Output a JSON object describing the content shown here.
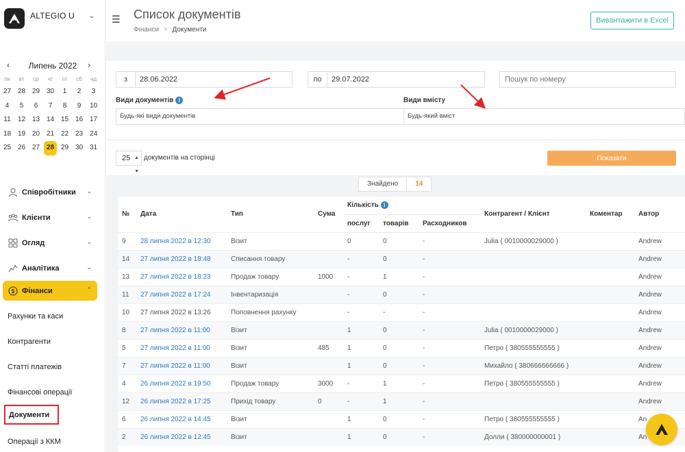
{
  "brand": {
    "name": "ALTEGIO U"
  },
  "calendar": {
    "month": "Липень 2022",
    "dow": [
      "пн",
      "вт",
      "ср",
      "чт",
      "пт",
      "сб",
      "нд"
    ],
    "days": [
      "27",
      "28",
      "29",
      "30",
      "1",
      "2",
      "3",
      "4",
      "5",
      "6",
      "7",
      "8",
      "9",
      "10",
      "11",
      "12",
      "13",
      "14",
      "15",
      "16",
      "17",
      "18",
      "19",
      "20",
      "21",
      "22",
      "23",
      "24",
      "25",
      "26",
      "27",
      "28",
      "29",
      "30",
      "31"
    ],
    "selected_index": 31
  },
  "nav": {
    "employees": "Співробітники",
    "clients": "Клієнти",
    "overview": "Огляд",
    "analytics": "Аналітика",
    "finances": "Фінанси",
    "sub": [
      "Рахунки та каси",
      "Контрагенти",
      "Статті платежів",
      "Фінансові операції",
      "Документи",
      "Операції з ККМ"
    ]
  },
  "header": {
    "title": "Список документів",
    "crumb_root": "Фінанси",
    "crumb_sep": ">",
    "crumb_current": "Документи",
    "excel_label": "Вивантажити в Excel"
  },
  "filters": {
    "from_prefix": "з",
    "from_value": "28.06.2022",
    "to_prefix": "по",
    "to_value": "29.07.2022",
    "search_placeholder": "Пошук по номеру",
    "doc_types_label": "Види документів",
    "doc_types_value": "Будь-які види документів",
    "content_label": "Види вмісту",
    "content_value": "Будь-який вміст",
    "info_glyph": "i"
  },
  "paging": {
    "per_page": "25",
    "per_page_label": "документів на сторінці",
    "show_label": "Показати",
    "found_label": "Знайдено",
    "found_count": "14"
  },
  "table": {
    "headers": {
      "no": "№",
      "date": "Дата",
      "type": "Тип",
      "sum": "Сума",
      "qty": "Кількість",
      "services": "послуг",
      "goods": "товарів",
      "consumables": "Расходников",
      "counterparty": "Контрагент / Клієнт",
      "comment": "Коментар",
      "author": "Автор"
    },
    "rows": [
      {
        "no": "9",
        "date": "28 липня 2022 в 12:30",
        "link": true,
        "type": "Візит",
        "sum": "",
        "services": "0",
        "goods": "0",
        "cons": "-",
        "party": "Julia ( 0010000029000 )",
        "comment": "",
        "author": "Andrew"
      },
      {
        "no": "14",
        "date": "27 липня 2022 в 18:48",
        "link": true,
        "type": "Списання товару",
        "sum": "",
        "services": "-",
        "goods": "0",
        "cons": "-",
        "party": "",
        "comment": "",
        "author": "Andrew"
      },
      {
        "no": "13",
        "date": "27 липня 2022 в 18:23",
        "link": true,
        "type": "Продаж товару",
        "sum": "1000",
        "services": "-",
        "goods": "1",
        "cons": "-",
        "party": "",
        "comment": "",
        "author": "Andrew"
      },
      {
        "no": "11",
        "date": "27 липня 2022 в 17:24",
        "link": true,
        "type": "Інвентаризація",
        "sum": "",
        "services": "-",
        "goods": "0",
        "cons": "-",
        "party": "",
        "comment": "",
        "author": "Andrew"
      },
      {
        "no": "10",
        "date": "27 липня 2022 в 13:26",
        "link": false,
        "type": "Поповнення рахунку",
        "sum": "",
        "services": "-",
        "goods": "-",
        "cons": "-",
        "party": "",
        "comment": "",
        "author": "Andrew"
      },
      {
        "no": "8",
        "date": "27 липня 2022 в 11:00",
        "link": true,
        "type": "Візит",
        "sum": "",
        "services": "1",
        "goods": "0",
        "cons": "-",
        "party": "Julia ( 0010000029000 )",
        "comment": "",
        "author": "Andrew"
      },
      {
        "no": "5",
        "date": "27 липня 2022 в 11:00",
        "link": true,
        "type": "Візит",
        "sum": "485",
        "services": "1",
        "goods": "0",
        "cons": "-",
        "party": "Петро ( 380555555555 )",
        "comment": "",
        "author": "Andrew"
      },
      {
        "no": "7",
        "date": "27 липня 2022 в 11:00",
        "link": true,
        "type": "Візит",
        "sum": "",
        "services": "1",
        "goods": "0",
        "cons": "-",
        "party": "Михайло ( 380666666666 )",
        "comment": "",
        "author": "Andrew"
      },
      {
        "no": "4",
        "date": "26 липня 2022 в 19:50",
        "link": true,
        "type": "Продаж товару",
        "sum": "3000",
        "services": "-",
        "goods": "1",
        "cons": "-",
        "party": "Петро ( 380555555555 )",
        "comment": "",
        "author": "Andrew"
      },
      {
        "no": "12",
        "date": "26 липня 2022 в 17:25",
        "link": true,
        "type": "Прихід товару",
        "sum": "0",
        "services": "-",
        "goods": "1",
        "cons": "-",
        "party": "",
        "comment": "",
        "author": "Andrew"
      },
      {
        "no": "6",
        "date": "26 липня 2022 в 14:45",
        "link": true,
        "type": "Візит",
        "sum": "",
        "services": "1",
        "goods": "0",
        "cons": "-",
        "party": "Петро ( 380555555555 )",
        "comment": "",
        "author": "An"
      },
      {
        "no": "2",
        "date": "26 липня 2022 в 12:45",
        "link": true,
        "type": "Візит",
        "sum": "",
        "services": "1",
        "goods": "0",
        "cons": "-",
        "party": "Долли ( 380000000001 )",
        "comment": "",
        "author": "An"
      }
    ]
  },
  "colors": {
    "accent": "#f5c518",
    "link": "#2f78c4",
    "excel": "#3cb3a6",
    "show": "#f6ab5a",
    "annotation": "#e0262a"
  }
}
